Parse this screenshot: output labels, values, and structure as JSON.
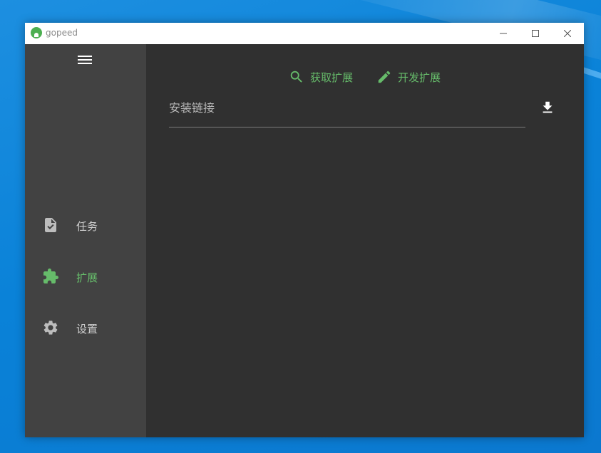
{
  "window": {
    "title": "gopeed",
    "controls": {
      "minimize_icon": "minimize-icon",
      "maximize_icon": "maximize-icon",
      "close_icon": "close-icon"
    }
  },
  "sidebar": {
    "menu_icon": "hamburger-menu-icon",
    "items": [
      {
        "label": "任务",
        "icon": "task-file-icon",
        "active": false
      },
      {
        "label": "扩展",
        "icon": "puzzle-extension-icon",
        "active": true
      },
      {
        "label": "设置",
        "icon": "gear-icon",
        "active": false
      }
    ]
  },
  "main": {
    "actions": [
      {
        "label": "获取扩展",
        "icon": "search-icon"
      },
      {
        "label": "开发扩展",
        "icon": "pencil-icon"
      }
    ],
    "install_field": {
      "placeholder": "安装链接",
      "value": ""
    },
    "download_icon": "download-icon"
  },
  "colors": {
    "accent": "#66bb6a",
    "sidebar_bg": "#424242",
    "main_bg": "#303030",
    "titlebar_bg": "#ffffff",
    "text_muted": "#cfcfcf"
  }
}
